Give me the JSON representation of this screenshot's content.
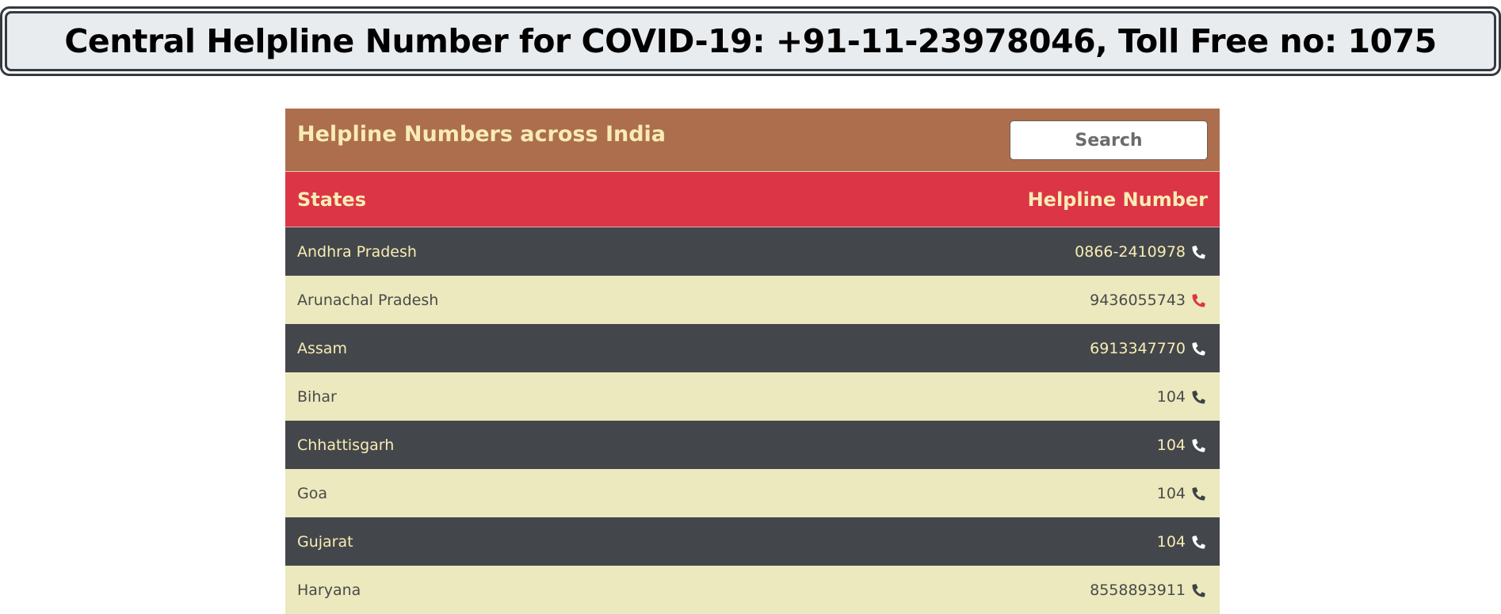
{
  "banner": {
    "text": "Central Helpline Number for COVID-19: +91-11-23978046, Toll Free no: 1075"
  },
  "panel": {
    "title": "Helpline Numbers across India",
    "search_placeholder": "Search"
  },
  "table": {
    "headers": {
      "states": "States",
      "number": "Helpline Number"
    },
    "rows": [
      {
        "state": "Andhra Pradesh",
        "number": "0866-2410978"
      },
      {
        "state": "Arunachal Pradesh",
        "number": "9436055743"
      },
      {
        "state": "Assam",
        "number": "6913347770"
      },
      {
        "state": "Bihar",
        "number": "104"
      },
      {
        "state": "Chhattisgarh",
        "number": "104"
      },
      {
        "state": "Goa",
        "number": "104"
      },
      {
        "state": "Gujarat",
        "number": "104"
      },
      {
        "state": "Haryana",
        "number": "8558893911"
      }
    ]
  },
  "icons": {
    "phone": "phone-icon"
  },
  "colors": {
    "header_bg": "#ad6e4e",
    "table_head_bg": "#dc3545",
    "row_dark": "#43474b",
    "row_light": "#ebe9bd",
    "accent_text": "#f8ecb5"
  }
}
